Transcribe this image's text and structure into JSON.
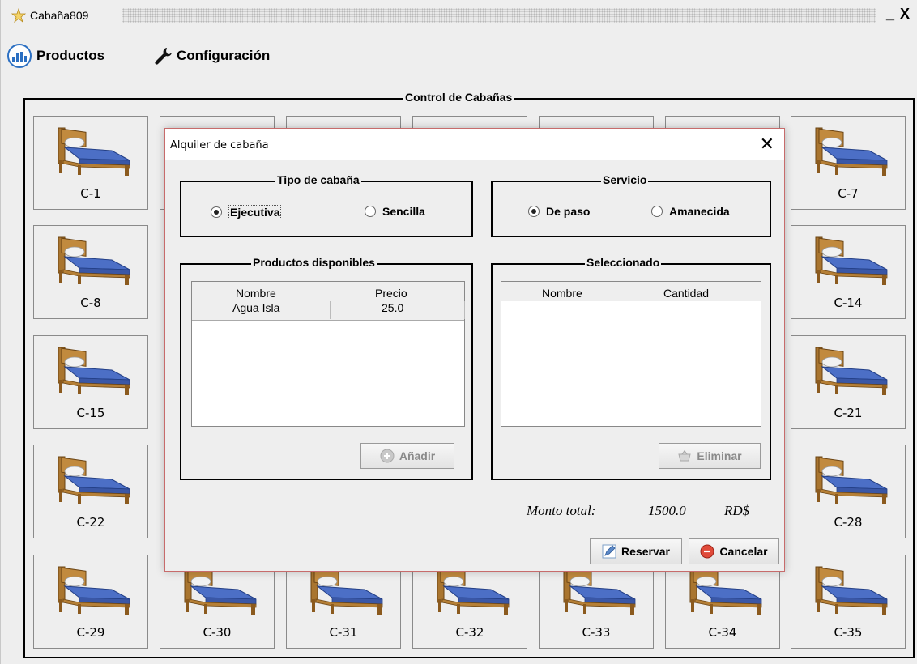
{
  "window": {
    "title": "Cabaña809",
    "minimize": "_",
    "close": "X"
  },
  "menu": {
    "products": "Productos",
    "config": "Configuración"
  },
  "control": {
    "title": "Control de Cabañas",
    "tiles": [
      "C-1",
      "C-7",
      "C-8",
      "C-14",
      "C-15",
      "C-21",
      "C-22",
      "C-28",
      "C-29",
      "C-30",
      "C-31",
      "C-32",
      "C-33",
      "C-34",
      "C-35"
    ]
  },
  "dialog": {
    "title": "Alquiler de cabaña",
    "close": "✕",
    "tipo": {
      "title": "Tipo de cabaña",
      "option1": "Ejecutiva",
      "option2": "Sencilla",
      "selected": "Ejecutiva"
    },
    "servicio": {
      "title": "Servicio",
      "option1": "De paso",
      "option2": "Amanecida",
      "selected": "De paso"
    },
    "productos": {
      "title": "Productos disponibles",
      "col_name": "Nombre",
      "col_price": "Precio",
      "rows": [
        {
          "name": "Agua Isla",
          "price": "25.0"
        }
      ],
      "add_button": "Añadir"
    },
    "seleccionado": {
      "title": "Seleccionado",
      "col_name": "Nombre",
      "col_qty": "Cantidad",
      "remove_button": "Eliminar"
    },
    "total": {
      "label": "Monto total:",
      "value": "1500.0",
      "currency": "RD$"
    },
    "reserve_button": "Reservar",
    "cancel_button": "Cancelar"
  }
}
